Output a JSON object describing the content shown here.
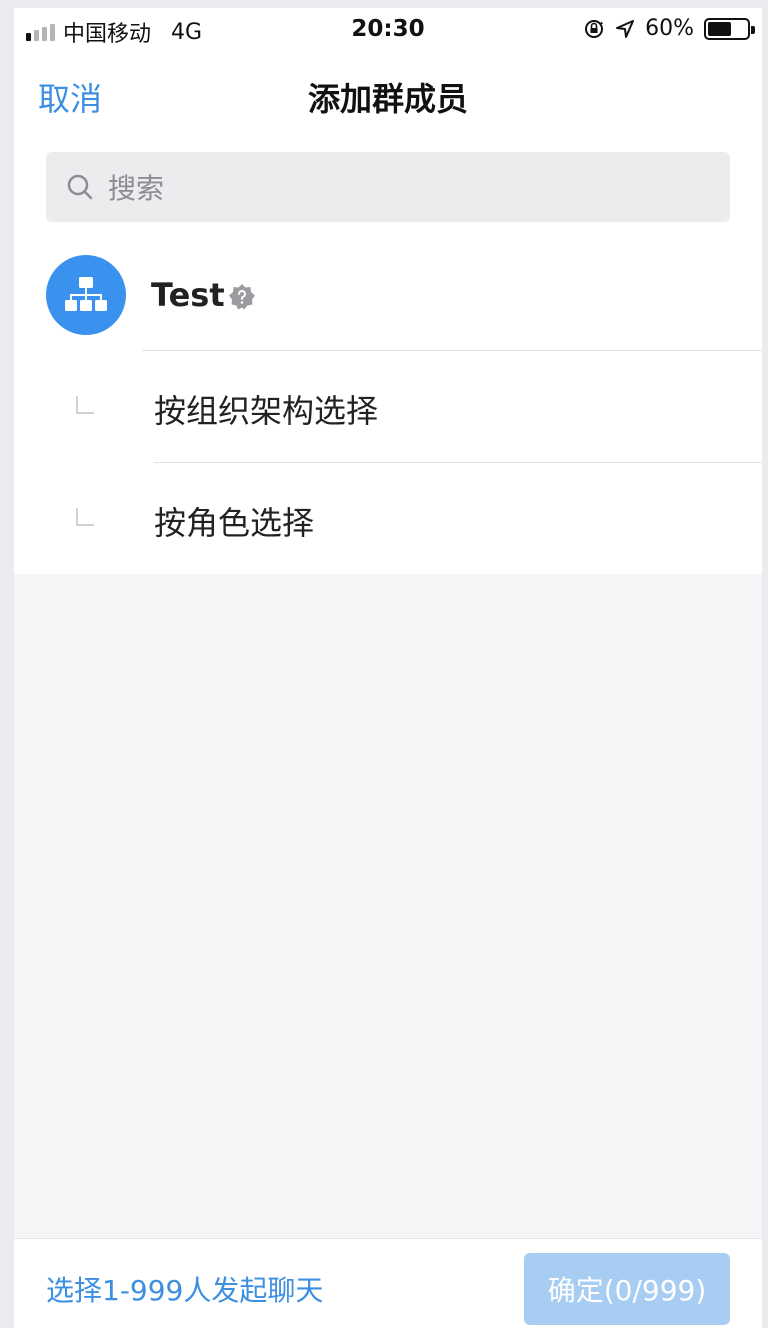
{
  "status_bar": {
    "carrier": "中国移动",
    "network": "4G",
    "time": "20:30",
    "battery": "60%",
    "battery_level": 0.6,
    "signal_bars_filled": 1,
    "signal_bars_total": 4
  },
  "nav": {
    "cancel_label": "取消",
    "title": "添加群成员"
  },
  "search": {
    "placeholder": "搜索"
  },
  "org": {
    "name": "Test"
  },
  "options": [
    {
      "label": "按组织架构选择"
    },
    {
      "label": "按角色选择"
    }
  ],
  "footer": {
    "hint": "选择1-999人发起聊天",
    "confirm_label": "确定(0/999)"
  },
  "colors": {
    "accent": "#3d8fe0",
    "avatar_bg": "#3a91ee",
    "confirm_disabled": "#a8cdf3"
  },
  "icons": [
    "signal-icon",
    "orientation-lock-icon",
    "location-icon",
    "battery-icon",
    "search-icon",
    "org-chart-icon",
    "verified-badge-icon",
    "tree-branch-icon"
  ]
}
